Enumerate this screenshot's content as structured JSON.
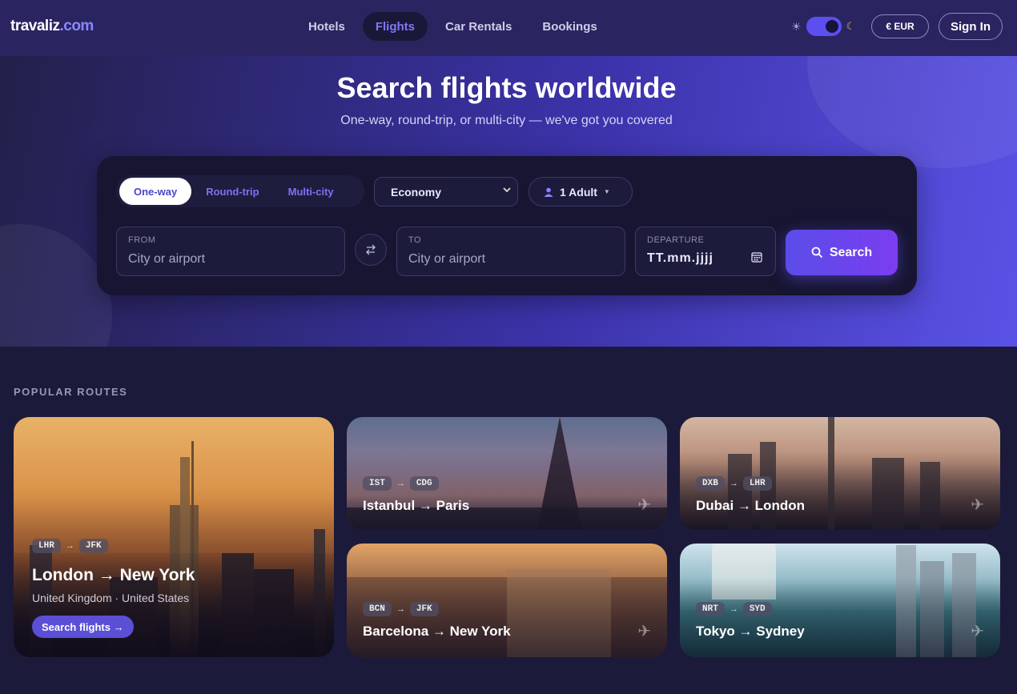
{
  "brand": {
    "name": "travaliz",
    "domain": ".com"
  },
  "nav": {
    "links": [
      "Hotels",
      "Flights",
      "Car Rentals",
      "Bookings"
    ],
    "active": "Flights",
    "theme_icons": [
      "sun-icon",
      "moon-icon"
    ],
    "currency": "€ EUR",
    "signin": "Sign In"
  },
  "hero": {
    "title": "Search flights worldwide",
    "subtitle": "One-way, round-trip, or multi-city — we've got you covered"
  },
  "search": {
    "trip_types": [
      "One-way",
      "Round-trip",
      "Multi-city"
    ],
    "trip_selected": "One-way",
    "cabin": "Economy",
    "passengers": "1 Adult",
    "from_label": "FROM",
    "from_placeholder": "City or airport",
    "to_label": "TO",
    "to_placeholder": "City or airport",
    "departure_label": "DEPARTURE",
    "departure_value": "TT.mm.jjjj",
    "button": "Search"
  },
  "popular": {
    "title": "POPULAR ROUTES",
    "featured": {
      "from_code": "LHR",
      "to_code": "JFK",
      "title": "London → New York",
      "subtitle": "United Kingdom · United States",
      "cta": "Search flights →"
    },
    "routes": [
      {
        "from_code": "IST",
        "to_code": "CDG",
        "title": "Istanbul → Paris"
      },
      {
        "from_code": "DXB",
        "to_code": "LHR",
        "title": "Dubai → London"
      },
      {
        "from_code": "BCN",
        "to_code": "JFK",
        "title": "Barcelona → New York"
      },
      {
        "from_code": "NRT",
        "to_code": "SYD",
        "title": "Tokyo → Sydney"
      }
    ]
  },
  "colors": {
    "nav_bg": "#2a2560",
    "accent": "#5b4ff0",
    "panel_bg": "#171531",
    "page_bg": "#1c1a3a"
  }
}
